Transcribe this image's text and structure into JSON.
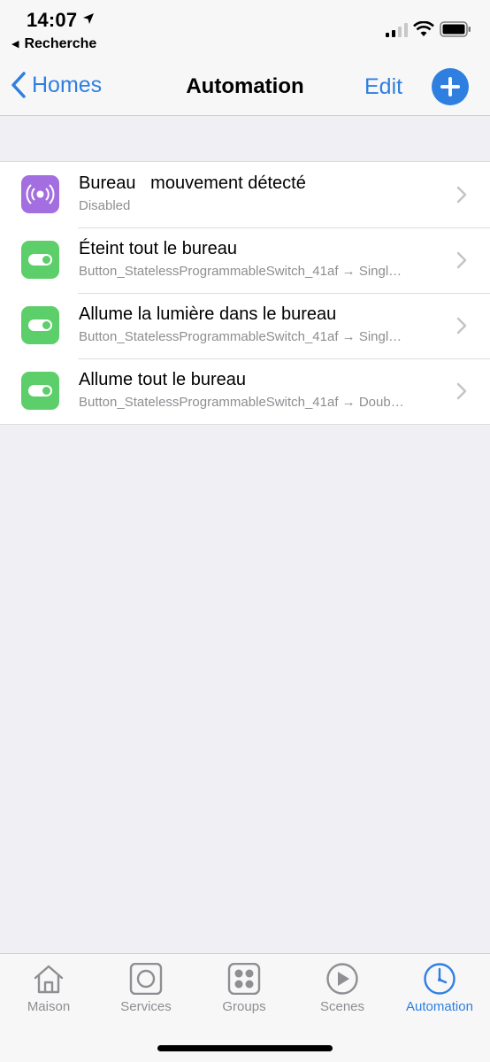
{
  "status": {
    "time": "14:07",
    "back_app": "Recherche"
  },
  "nav": {
    "back_label": "Homes",
    "title": "Automation",
    "edit_label": "Edit"
  },
  "automations": [
    {
      "title": "Bureau   mouvement détecté",
      "subtitle": "Disabled",
      "icon": "motion-sensor-icon",
      "color": "#a36ee0"
    },
    {
      "title": "Éteint tout le bureau",
      "subtitle": "Button_StatelessProgrammableSwitch_41af → Singl…",
      "icon": "toggle-icon",
      "color": "#5ccf6a"
    },
    {
      "title": "Allume la lumière dans le bureau",
      "subtitle": "Button_StatelessProgrammableSwitch_41af → Singl…",
      "icon": "toggle-icon",
      "color": "#5ccf6a"
    },
    {
      "title": "Allume tout le bureau",
      "subtitle": "Button_StatelessProgrammableSwitch_41af → Doub…",
      "icon": "toggle-icon",
      "color": "#5ccf6a"
    }
  ],
  "tabs": [
    {
      "label": "Maison",
      "icon": "house-icon"
    },
    {
      "label": "Services",
      "icon": "services-icon"
    },
    {
      "label": "Groups",
      "icon": "groups-icon"
    },
    {
      "label": "Scenes",
      "icon": "play-icon"
    },
    {
      "label": "Automation",
      "icon": "clock-icon",
      "active": true
    }
  ],
  "colors": {
    "accent": "#2f7fe0",
    "background": "#efeff4",
    "secondary_text": "#8e8e93"
  }
}
